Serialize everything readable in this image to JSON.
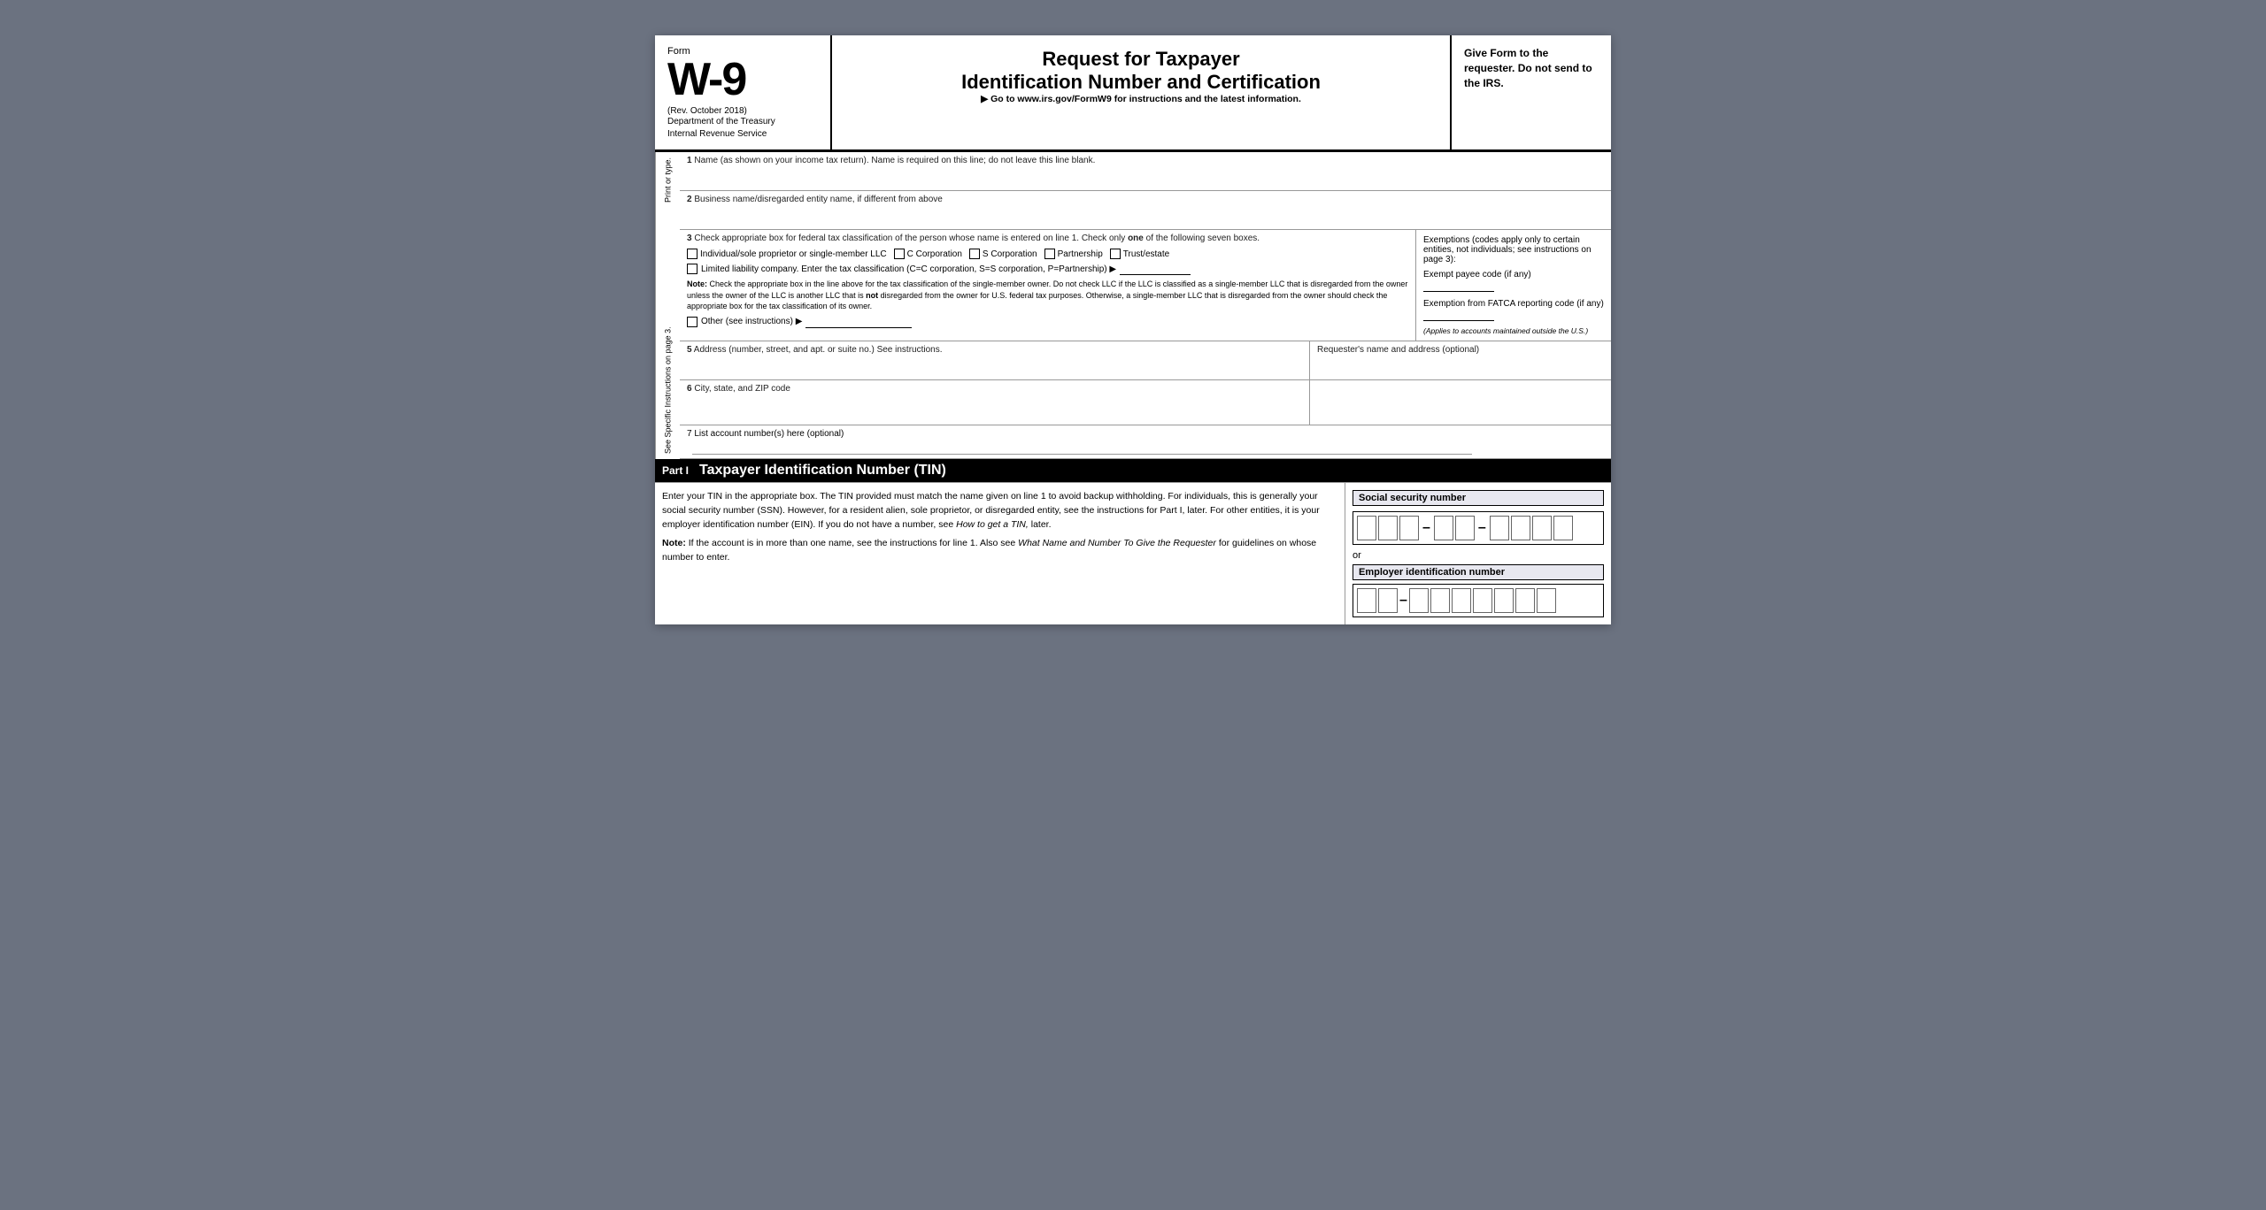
{
  "form": {
    "number": "W-9",
    "form_label": "Form",
    "rev": "(Rev. October 2018)",
    "dept1": "Department of the Treasury",
    "dept2": "Internal Revenue Service",
    "title1": "Request for Taxpayer",
    "title2": "Identification Number and Certification",
    "goto": "▶ Go to www.irs.gov/FormW9 for instructions and the latest information.",
    "give_form": "Give Form to the requester. Do not send to the IRS."
  },
  "side_label": {
    "top": "Print or type.",
    "bottom": "See Specific Instructions on page 3."
  },
  "fields": {
    "f1_label": "Name (as shown on your income tax return). Name is required on this line; do not leave this line blank.",
    "f1_num": "1",
    "f2_label": "Business name/disregarded entity name, if different from above",
    "f2_num": "2",
    "f3_label": "Check appropriate box for federal tax classification of the person whose name is entered on line 1. Check only",
    "f3_label_one": "one",
    "f3_label_end": "of the following seven boxes.",
    "f3_num": "3",
    "checkbox_individual": "Individual/sole proprietor or single-member LLC",
    "checkbox_c_corp": "C Corporation",
    "checkbox_s_corp": "S Corporation",
    "checkbox_partnership": "Partnership",
    "checkbox_trust": "Trust/estate",
    "llc_label": "Limited liability company. Enter the tax classification (C=C corporation, S=S corporation, P=Partnership) ▶",
    "note_label": "Note:",
    "note_text": "Check the appropriate box in the line above for the tax classification of the single-member owner.  Do not check LLC if the LLC is classified as a single-member LLC that is disregarded from the owner unless the owner of the LLC is another LLC that is",
    "note_not": "not",
    "note_text2": "disregarded from the owner for U.S. federal tax purposes. Otherwise, a single-member LLC that is disregarded from the owner should check the appropriate box for the tax classification of its owner.",
    "other_label": "Other (see instructions) ▶",
    "f4_label": "Exemptions (codes apply only to certain entities, not individuals; see instructions on page 3):",
    "exempt_payee_label": "Exempt payee code (if any)",
    "fatca_label": "Exemption from FATCA reporting code (if any)",
    "applies_text": "(Applies to accounts maintained outside the U.S.)",
    "f5_label": "Address (number, street, and apt. or suite no.) See instructions.",
    "f5_num": "5",
    "requester_label": "Requester's name and address (optional)",
    "f6_label": "City, state, and ZIP code",
    "f6_num": "6",
    "f7_label": "List account number(s) here (optional)",
    "f7_num": "7"
  },
  "part1": {
    "label": "Part I",
    "title": "Taxpayer Identification Number (TIN)",
    "body1": "Enter your TIN in the appropriate box. The TIN provided must match the name given on line 1 to avoid backup withholding. For individuals, this is generally your social security number (SSN). However, for a resident alien, sole proprietor, or disregarded entity, see the instructions for Part I, later. For other entities, it is your employer identification number (EIN). If you do not have a number, see",
    "how_to_get": "How to get a TIN,",
    "body1_end": "later.",
    "note_label": "Note:",
    "note_body": "If the account is in more than one name, see the instructions for line 1. Also see",
    "what_name": "What Name and Number To Give the Requester",
    "note_end": "for guidelines on whose number to enter.",
    "ssn_label": "Social security number",
    "or_text": "or",
    "ein_label": "Employer identification number"
  }
}
